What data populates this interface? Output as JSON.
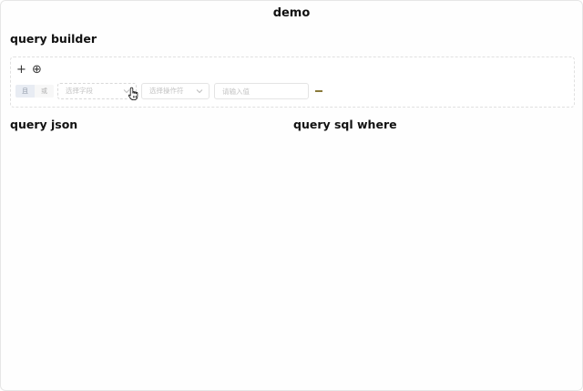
{
  "page": {
    "title": "demo"
  },
  "query_builder": {
    "heading": "query builder",
    "toolbar": {
      "add_rule_label": "+",
      "add_rule_icon": "plus-icon",
      "add_group_label": "⊕",
      "add_group_icon": "circle-plus-icon"
    },
    "rule": {
      "logic_options": [
        "且",
        "或"
      ],
      "logic_selected": "且",
      "field_placeholder": "选择字段",
      "operator_placeholder": "选择操作符",
      "value_placeholder": "请输入值",
      "chevron_icon": "chevron-down-icon",
      "remove_icon": "minus-icon"
    }
  },
  "query_json": {
    "heading": "query json"
  },
  "query_sql": {
    "heading": "query sql where"
  },
  "colors": {
    "accent": "#8a7a3a",
    "border": "#e4e4e4",
    "placeholder": "#c4c4c4",
    "logic_active_bg": "#e8ecf3"
  }
}
